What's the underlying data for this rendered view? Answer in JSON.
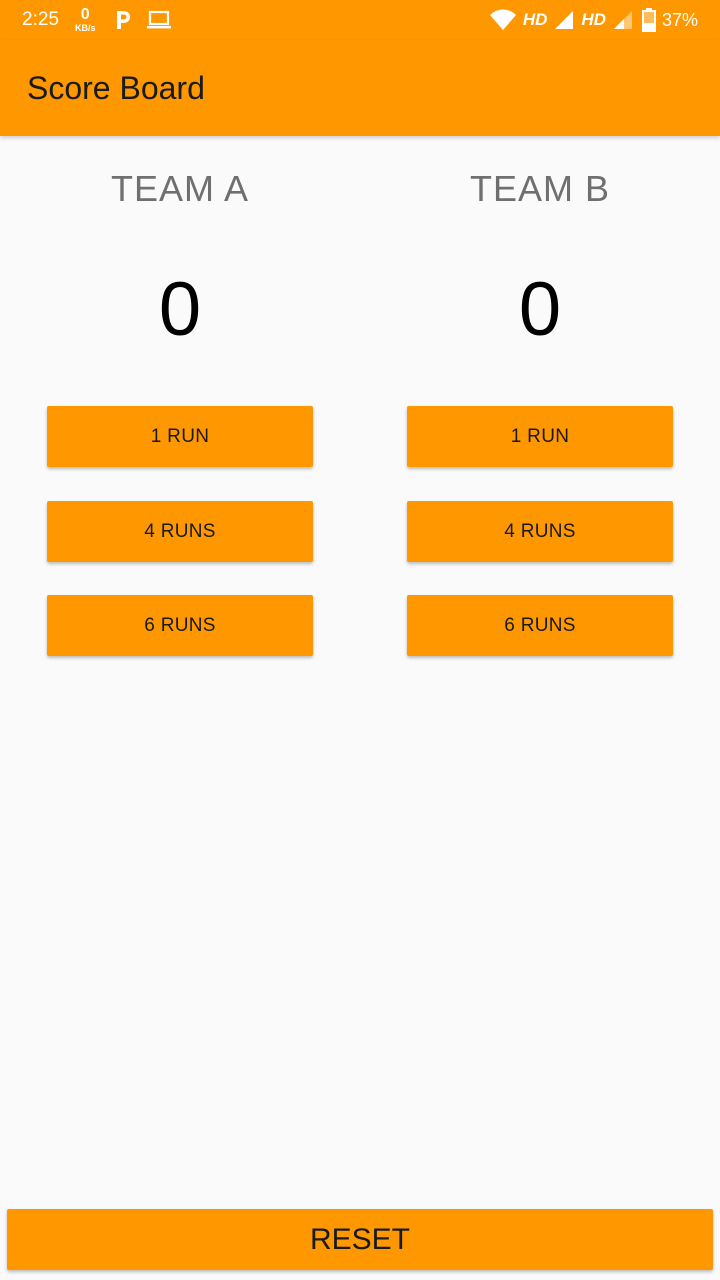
{
  "status_bar": {
    "time": "2:25",
    "net_speed_value": "0",
    "net_speed_unit": "KB/s",
    "hd_label_1": "HD",
    "hd_label_2": "HD",
    "battery": "37%",
    "icons": [
      "p-icon",
      "laptop-icon",
      "wifi-icon",
      "signal-icon",
      "signal-icon-2",
      "battery-icon"
    ]
  },
  "app_bar": {
    "title": "Score Board"
  },
  "team_a": {
    "name": "TEAM A",
    "score": "0",
    "buttons": {
      "one_run": "1 RUN",
      "four_runs": "4 RUNS",
      "six_runs": "6 RUNS"
    }
  },
  "team_b": {
    "name": "TEAM B",
    "score": "0",
    "buttons": {
      "one_run": "1 RUN",
      "four_runs": "4 RUNS",
      "six_runs": "6 RUNS"
    }
  },
  "reset_label": "RESET",
  "colors": {
    "accent": "#ff9800",
    "background": "#fafafa",
    "team_name": "#6f6f6f",
    "score": "#000000"
  }
}
